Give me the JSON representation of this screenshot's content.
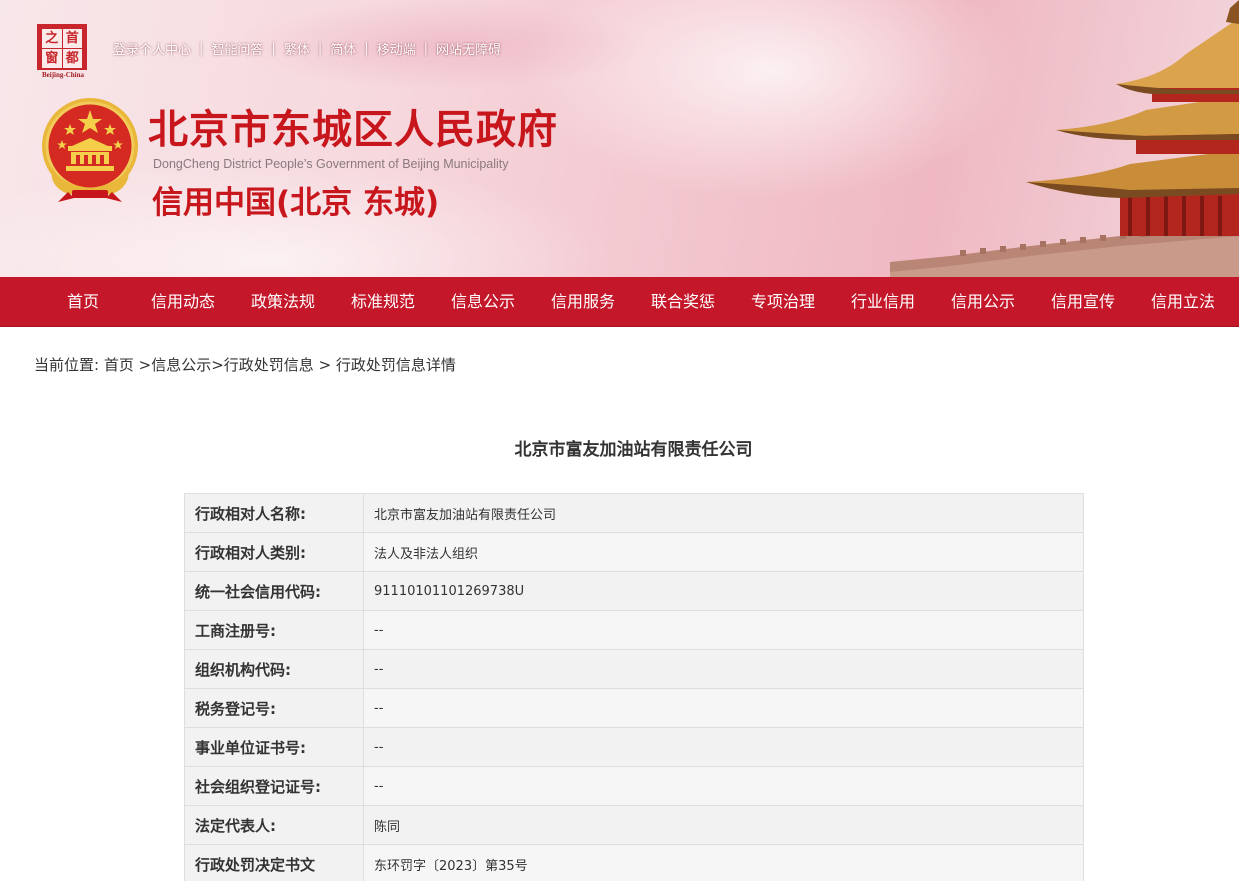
{
  "header": {
    "seal_chars": [
      "之",
      "首",
      "窗",
      "都"
    ],
    "seal_caption": "Beijing-China",
    "top_links": [
      "登录个人中心",
      "智能问答",
      "繁体",
      "简体",
      "移动端",
      "网站无障碍"
    ],
    "title": "北京市东城区人民政府",
    "subtitle": "DongCheng District People’s Government of Beijing Municipality",
    "title2": "信用中国(北京 东城)"
  },
  "nav": {
    "items": [
      "首页",
      "信用动态",
      "政策法规",
      "标准规范",
      "信息公示",
      "信用服务",
      "联合奖惩",
      "专项治理",
      "行业信用",
      "信用公示",
      "信用宣传",
      "信用立法"
    ]
  },
  "breadcrumb": {
    "prefix": "当前位置:",
    "home": "首页",
    "sep1": " >",
    "info": "信息公示",
    "sep2": ">",
    "penalty": "行政处罚信息",
    "sep3": " > ",
    "current": "行政处罚信息详情"
  },
  "record": {
    "title": "北京市富友加油站有限责任公司",
    "rows": [
      {
        "label": "行政相对人名称:",
        "value": "北京市富友加油站有限责任公司"
      },
      {
        "label": "行政相对人类别:",
        "value": "法人及非法人组织"
      },
      {
        "label": "统一社会信用代码:",
        "value": "91110101101269738U"
      },
      {
        "label": "工商注册号:",
        "value": "--"
      },
      {
        "label": "组织机构代码:",
        "value": "--"
      },
      {
        "label": "税务登记号:",
        "value": "--"
      },
      {
        "label": "事业单位证书号:",
        "value": "--"
      },
      {
        "label": "社会组织登记证号:",
        "value": "--"
      },
      {
        "label": "法定代表人:",
        "value": "陈同"
      },
      {
        "label": "行政处罚决定书文",
        "value": "东环罚字〔2023〕第35号"
      }
    ]
  },
  "colors": {
    "brand_red": "#c8161d",
    "nav_red": "#c5172a"
  }
}
